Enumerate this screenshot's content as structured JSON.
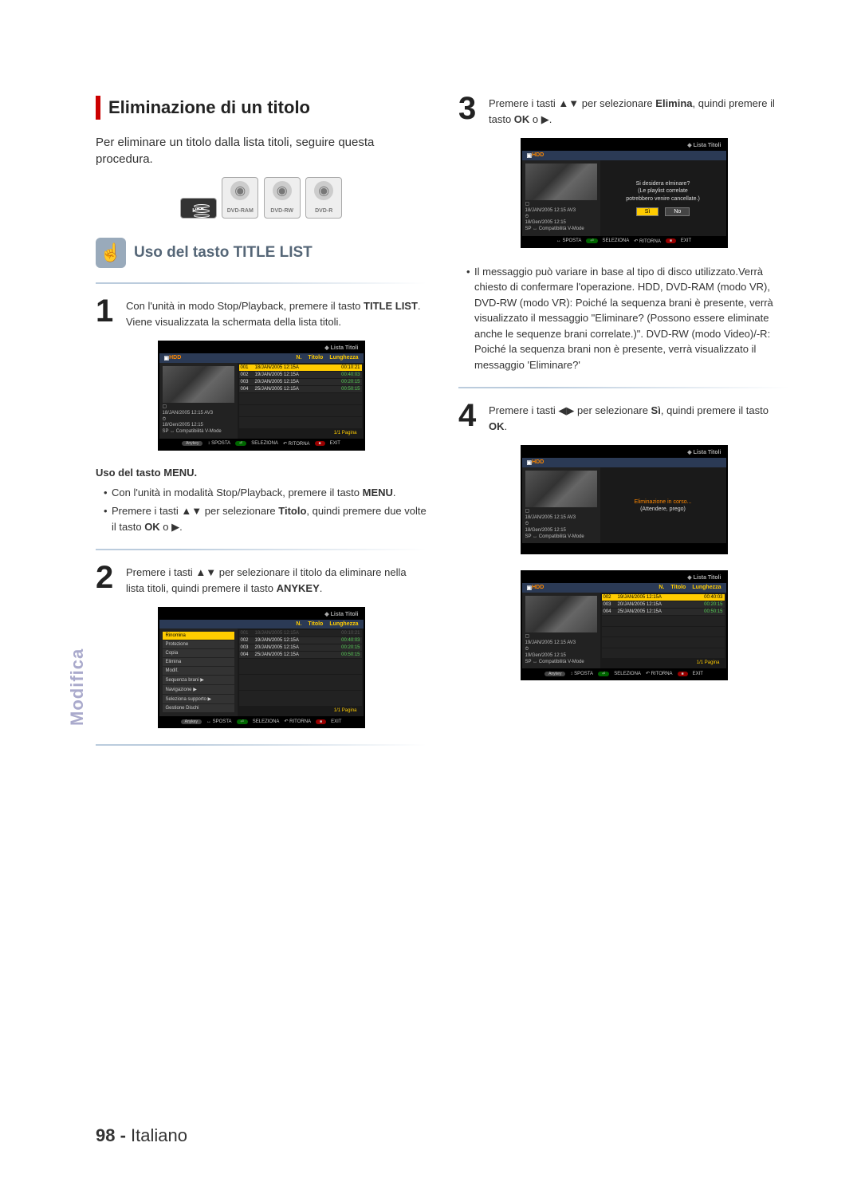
{
  "side_tab": "Modifica",
  "page_number": "98 -",
  "page_lang": "Italiano",
  "left": {
    "section_title": "Eliminazione di un titolo",
    "intro": "Per eliminare un titolo dalla lista titoli, seguire questa procedura.",
    "discs": [
      "HDD",
      "DVD-RAM",
      "DVD-RW",
      "DVD-R"
    ],
    "subheading": "Uso del tasto TITLE LIST",
    "step1": {
      "num": "1",
      "line1_a": "Con l'unità in modo Stop/Playback, premere il tasto ",
      "line1_bold": "TITLE LIST",
      "line1_b": ".",
      "line2": "Viene visualizzata la schermata della lista titoli."
    },
    "tv1": {
      "header": "Lista Titoli",
      "brand": "HDD",
      "colN": "N.",
      "colT": "Titolo",
      "colL": "Lunghezza",
      "rows": [
        {
          "n": "001",
          "t": "18/JAN/2005 12:15A",
          "d": "00:10:21",
          "sel": true
        },
        {
          "n": "002",
          "t": "19/JAN/2005 12:15A",
          "d": "00:40:03"
        },
        {
          "n": "003",
          "t": "20/JAN/2005 12:15A",
          "d": "00:20:15"
        },
        {
          "n": "004",
          "t": "25/JAN/2005 12:15A",
          "d": "00:50:15"
        }
      ],
      "info1": "18/JAN/2005 12:15 AV3",
      "info2": "18/Gen/2005 12:15",
      "info3": "SP ↔ Compatibilità V-Mode",
      "page": "1/1 Pagina",
      "foot": [
        "SPOSTA",
        "SELEZIONA",
        "RITORNA",
        "EXIT"
      ]
    },
    "menu_head": "Uso del tasto MENU.",
    "menu_b1_a": "Con l'unità in modalità Stop/Playback, premere il tasto ",
    "menu_b1_bold": "MENU",
    "menu_b1_b": ".",
    "menu_b2_a": "Premere i tasti ",
    "menu_b2_arrows": "▲▼",
    "menu_b2_b": " per selezionare ",
    "menu_b2_bold1": "Titolo",
    "menu_b2_c": ", quindi premere due volte il tasto ",
    "menu_b2_bold2": "OK",
    "menu_b2_d": " o ",
    "menu_b2_tri": "▶",
    "menu_b2_e": ".",
    "step2": {
      "num": "2",
      "a": "Premere i tasti ",
      "arrows": "▲▼",
      "b": " per selezionare il titolo da eliminare nella lista titoli, quindi premere il tasto ",
      "bold": "ANYKEY",
      "c": "."
    },
    "tv2": {
      "header": "Lista Titoli",
      "colN": "N.",
      "colT": "Titolo",
      "colL": "Lunghezza",
      "menu": [
        "Rinomina",
        "Protezione",
        "Copia",
        "Elimina",
        "Modif.",
        "Sequenza brani  ▶",
        "Navigazione  ▶",
        "Seleziona supporto ▶",
        "Gestione Dischi"
      ],
      "menu_sel_index": 0,
      "rows": [
        {
          "n": "001",
          "t": "18/JAN/2005 12:15A",
          "d": "00:10:21",
          "dim": true
        },
        {
          "n": "002",
          "t": "19/JAN/2005 12:15A",
          "d": "00:40:03"
        },
        {
          "n": "003",
          "t": "20/JAN/2005 12:15A",
          "d": "00:20:15"
        },
        {
          "n": "004",
          "t": "25/JAN/2005 12:15A",
          "d": "00:50:15"
        }
      ],
      "page": "1/1 Pagina",
      "foot": [
        "SPOSTA",
        "SELEZIONA",
        "RITORNA",
        "EXIT"
      ]
    }
  },
  "right": {
    "step3": {
      "num": "3",
      "a": "Premere i tasti ",
      "arrows": "▲▼",
      "b": " per selezionare ",
      "bold1": "Elimina",
      "c": ", quindi premere il tasto ",
      "bold2": "OK",
      "d": " o ",
      "tri": "▶",
      "e": "."
    },
    "tv3": {
      "header": "Lista Titoli",
      "brand": "HDD",
      "msg1": "Si desidera elminare?",
      "msg2": "(Le playlist correlate",
      "msg3": "potrebbero venire cancellate.)",
      "btn_yes": "Sì",
      "btn_no": "No",
      "info1": "18/JAN/2005 12:15 AV3",
      "info2": "18/Gen/2005 12:15",
      "info3": "SP ↔ Compatibilità V-Mode",
      "foot": [
        "SPOSTA",
        "SELEZIONA",
        "RITORNA",
        "EXIT"
      ]
    },
    "note": "Il messaggio può variare in base al tipo di disco utilizzato.Verrà chiesto di confermare l'operazione. HDD, DVD-RAM (modo VR), DVD-RW (modo VR): Poiché la sequenza brani è presente, verrà visualizzato il messaggio \"Eliminare? (Possono essere eliminate anche le sequenze brani correlate.)\". DVD-RW (modo Video)/-R: Poiché la sequenza brani non è presente, verrà visualizzato il messaggio 'Eliminare?'",
    "step4": {
      "num": "4",
      "a": "Premere i tasti ",
      "arrows": "◀▶",
      "b": " per selezionare ",
      "bold1": "Sì",
      "c": ", quindi premere il tasto ",
      "bold2": "OK",
      "d": "."
    },
    "tv4": {
      "header": "Lista Titoli",
      "brand": "HDD",
      "msg1": "Eliminazione in corso...",
      "msg2": "(Attendere, prego)",
      "info1": "18/JAN/2005 12:15 AV3",
      "info2": "18/Gen/2005 12:15",
      "info3": "SP ↔ Compatibilità V-Mode"
    },
    "tv5": {
      "header": "Lista Titoli",
      "brand": "HDD",
      "colN": "N.",
      "colT": "Titolo",
      "colL": "Lunghezza",
      "rows": [
        {
          "n": "002",
          "t": "19/JAN/2005 12:15A",
          "d": "00:40:03",
          "sel": true
        },
        {
          "n": "003",
          "t": "20/JAN/2005 12:15A",
          "d": "00:20:15"
        },
        {
          "n": "004",
          "t": "25/JAN/2005 12:15A",
          "d": "00:50:15"
        }
      ],
      "info1": "19/JAN/2005 12:15 AV3",
      "info2": "19/Gen/2005 12:15",
      "info3": "SP ↔ Compatibilità V-Mode",
      "page": "1/1 Pagina",
      "foot": [
        "SPOSTA",
        "SELEZIONA",
        "RITORNA",
        "EXIT"
      ]
    }
  },
  "anykey_pill": "Anykey"
}
